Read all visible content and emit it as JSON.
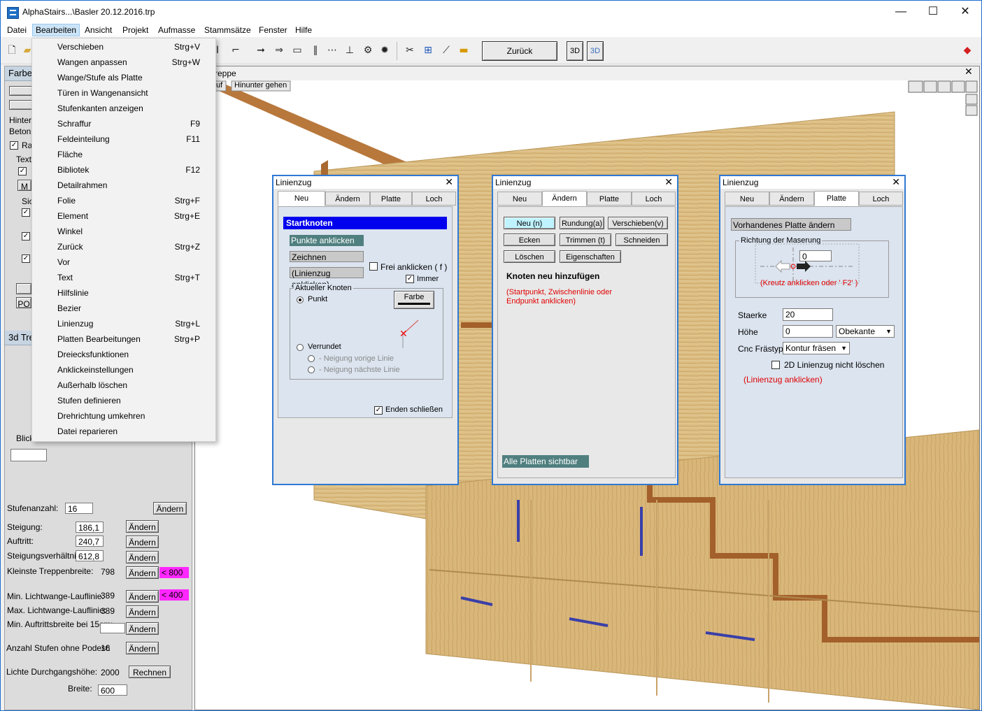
{
  "window": {
    "title": "AlphaStairs...\\Basler 20.12.2016.trp",
    "minimize": "—",
    "maximize": "☐",
    "close": "✕"
  },
  "menubar": [
    "Datei",
    "Bearbeiten",
    "Ansicht",
    "Projekt",
    "Aufmasse",
    "Stammsätze",
    "Fenster",
    "Hilfe"
  ],
  "toolbar": {
    "zurueck": "Zurück",
    "btn3d": "3D",
    "btn3d2": "3D"
  },
  "dropdown": [
    {
      "label": "Verschieben",
      "shortcut": "Strg+V"
    },
    {
      "label": "Wangen anpassen",
      "shortcut": "Strg+W"
    },
    {
      "label": "Wange/Stufe als Platte",
      "shortcut": ""
    },
    {
      "label": "Türen in Wangenansicht",
      "shortcut": ""
    },
    {
      "label": "Stufenkanten anzeigen",
      "shortcut": ""
    },
    {
      "label": "Schraffur",
      "shortcut": "F9"
    },
    {
      "label": "Feldeinteilung",
      "shortcut": "F11"
    },
    {
      "label": "Fläche",
      "shortcut": ""
    },
    {
      "label": "Bibliotek",
      "shortcut": "F12"
    },
    {
      "label": "Detailrahmen",
      "shortcut": ""
    },
    {
      "label": "Folie",
      "shortcut": "Strg+F"
    },
    {
      "label": "Element",
      "shortcut": "Strg+E"
    },
    {
      "label": "Winkel",
      "shortcut": ""
    },
    {
      "label": "Zurück",
      "shortcut": "Strg+Z"
    },
    {
      "label": "Vor",
      "shortcut": ""
    },
    {
      "label": "Text",
      "shortcut": "Strg+T"
    },
    {
      "label": "Hilfslinie",
      "shortcut": ""
    },
    {
      "label": "Bezier",
      "shortcut": ""
    },
    {
      "label": "Linienzug",
      "shortcut": "Strg+L"
    },
    {
      "label": "Platten Bearbeitungen",
      "shortcut": "Strg+P"
    },
    {
      "label": "Dreiecksfunktionen",
      "shortcut": ""
    },
    {
      "label": "Anklickeinstellungen",
      "shortcut": ""
    },
    {
      "label": "Außerhalb löschen",
      "shortcut": ""
    },
    {
      "label": "Stufen definieren",
      "shortcut": ""
    },
    {
      "label": "Drehrichtung umkehren",
      "shortcut": ""
    },
    {
      "label": "Datei reparieren",
      "shortcut": ""
    }
  ],
  "left_panel": {
    "header": "Farbe",
    "hinter": "Hinter",
    "beton": "Beton",
    "ra": "Ra",
    "text": "Text",
    "m": "M",
    "sic": "Sic",
    "po": "PO",
    "header3d": "3d Tre",
    "blick": "Blick",
    "stufenanzahl_label": "Stufenanzahl:",
    "stufenanzahl": "16",
    "steigung_label": "Steigung:",
    "steigung": "186,1",
    "auftritt_label": "Auftritt:",
    "auftritt": "240,7",
    "steigungsverh_label": "Steigungsverhältnis:",
    "steigungsverh": "612,8",
    "kl_breite_label": "Kleinste Treppenbreite:",
    "kl_breite": "798",
    "kl_breite_warn": "< 800",
    "min_licht_label": "Min. Lichtwange-Lauflinie:",
    "min_licht": "389",
    "min_licht_warn": "< 400",
    "max_licht_label": "Max. Lichtwange-Lauflinie:",
    "max_licht": "389",
    "min_auftritt_label": "Min. Auftrittsbreite bei 15cm:",
    "min_auftritt": "",
    "anzahl_podest_label": "Anzahl Stufen ohne Podest:",
    "anzahl_podest": "16",
    "lichte_label": "Lichte Durchgangshöhe:",
    "lichte": "2000",
    "breite_label": "Breite:",
    "breite": "600",
    "aendern": "Ändern",
    "rechnen": "Rechnen"
  },
  "viewport": {
    "title": "reppe",
    "tab1": "uf",
    "tab2": "Hinunter gehen"
  },
  "dialog1": {
    "title": "Linienzug",
    "tabs": [
      "Neu",
      "Ändern",
      "Platte",
      "Loch"
    ],
    "heading": "Startknoten",
    "punkte": "Punkte anklicken",
    "zeichnen": "Zeichnen",
    "linienzug": "(Linienzug anklicken)",
    "frei": "Frei anklicken ( f )",
    "immer": "Immer",
    "group": "Aktueller Knoten",
    "punkt": "Punkt",
    "farbe": "Farbe",
    "verrundet": "Verrundet",
    "neigung_vorige": "- Neigung vorige Linie",
    "neigung_naechste": "- Neigung nächste Linie",
    "enden": "Enden schließen"
  },
  "dialog2": {
    "title": "Linienzug",
    "tabs": [
      "Neu",
      "Ändern",
      "Platte",
      "Loch"
    ],
    "btn_neu": "Neu (n)",
    "btn_rundung": "Rundung(a)",
    "btn_verschieben": "Verschieben(v)",
    "btn_ecken": "Ecken",
    "btn_trimmen": "Trimmen (t)",
    "btn_schneiden": "Schneiden",
    "btn_loeschen": "Löschen",
    "btn_eigenschaften": "Eigenschaften",
    "heading": "Knoten neu hinzufügen",
    "hint1": "(Startpunkt, Zwischenlinie oder",
    "hint2": "Endpunkt anklicken)",
    "alle": "Alle Platten sichtbar"
  },
  "dialog3": {
    "title": "Linienzug",
    "tabs": [
      "Neu",
      "Ändern",
      "Platte",
      "Loch"
    ],
    "vorhanden": "Vorhandenes Platte ändern",
    "group": "Richtung der Maserung",
    "mas_value": "0",
    "kreuz": "(Kreutz anklicken oder ' F2' )",
    "staerke_label": "Staerke",
    "staerke": "20",
    "hoehe_label": "Höhe",
    "hoehe": "0",
    "hoehe_sel": "Obekante",
    "cnc_label": "Cnc Frästyp",
    "cnc": "Kontur fräsen",
    "nicht_loeschen": "2D Linienzug nicht löschen",
    "hint": "(Linienzug anklicken)"
  },
  "colors": {
    "wood": "#d9b97a",
    "accent": "#2f79d4",
    "teal": "#507f7f",
    "warn": "#ff26ff"
  }
}
